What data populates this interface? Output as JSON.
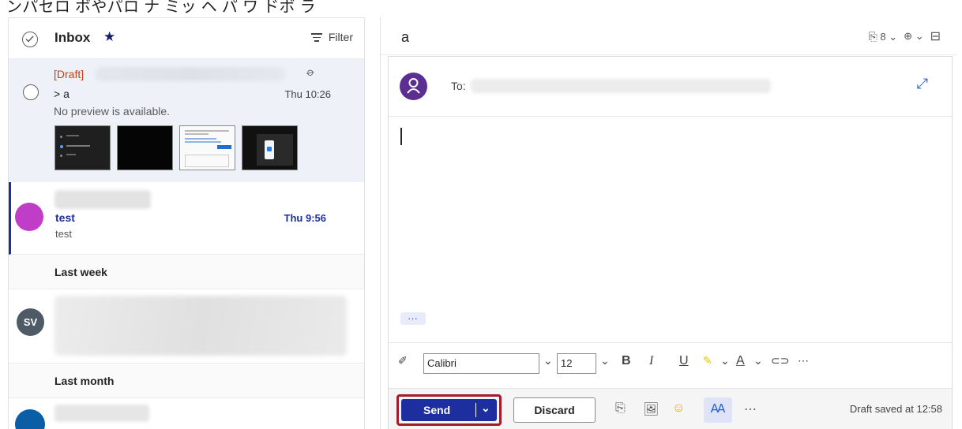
{
  "top_fragment": "ンパセロ ボやパロ ナ ミッ ヘ パ ワ ドボ ラ",
  "list": {
    "title": "Inbox",
    "filter_label": "Filter",
    "messages": [
      {
        "draft_tag": "[Draft]",
        "subject": "> a",
        "time": "Thu 10:26",
        "preview": "No preview is available."
      },
      {
        "subject": "test",
        "time": "Thu 9:56",
        "preview": "test"
      },
      {
        "avatar_initials": "SV"
      }
    ],
    "groups": [
      "Last week",
      "Last month"
    ]
  },
  "reading": {
    "subject": "a",
    "attachment_count": "8",
    "to_label": "To:",
    "font_name": "Calibri",
    "font_size": "12",
    "send_label": "Send",
    "discard_label": "Discard",
    "draft_status": "Draft saved at 12:58"
  },
  "colors": {
    "accent": "#1d2f9e",
    "send_outline": "#a01b2b",
    "draft_red": "#c4421a",
    "avatar_test": "#c03dc7",
    "avatar_me": "#5c2e91",
    "avatar_sv": "#4e5a66"
  }
}
